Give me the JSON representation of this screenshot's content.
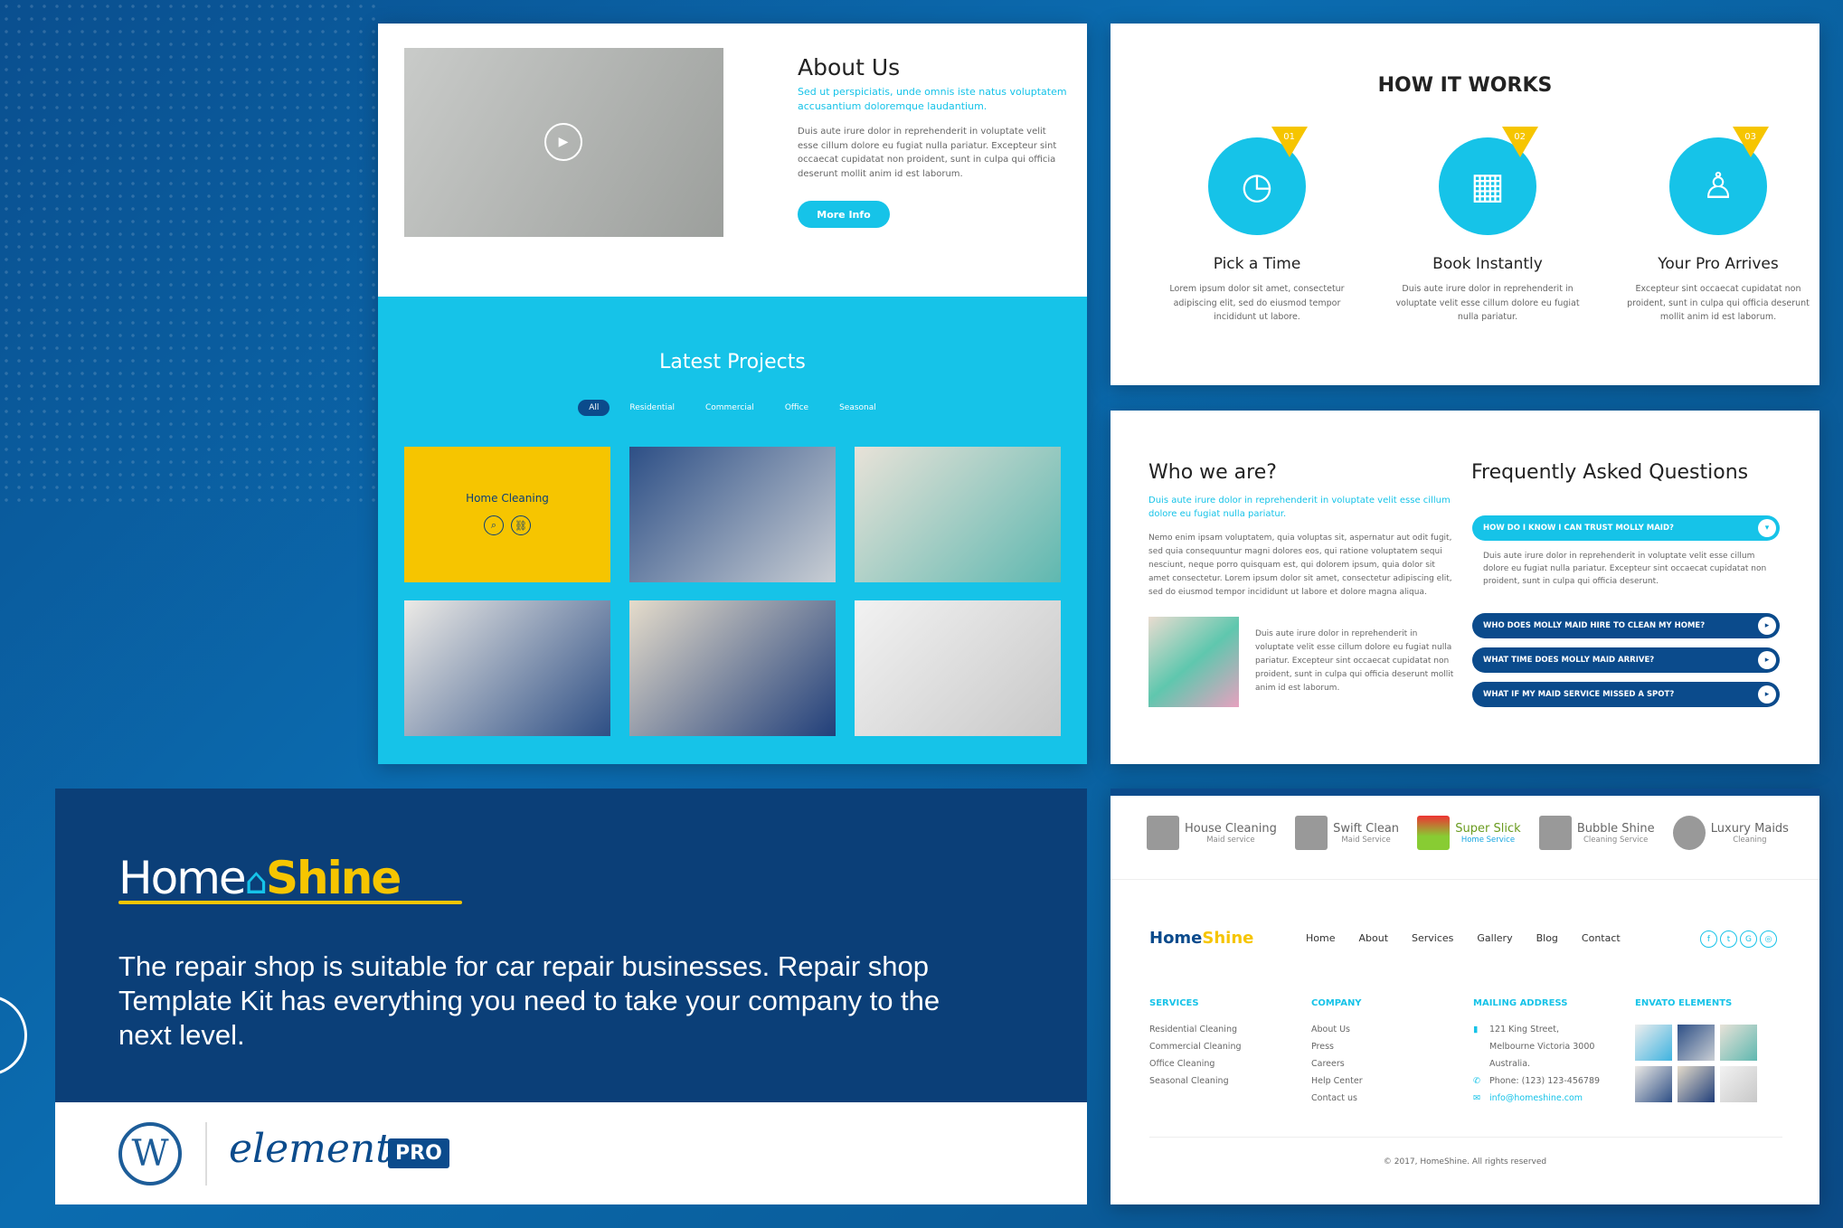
{
  "about": {
    "title": "About Us",
    "lead": "Sed ut perspiciatis, unde omnis iste natus voluptatem accusantium doloremque laudantium.",
    "body": "Duis aute irure dolor in reprehenderit in voluptate velit esse cillum dolore eu fugiat nulla pariatur. Excepteur sint occaecat cupidatat non proident, sunt in culpa qui officia deserunt mollit anim id est laborum.",
    "button": "More Info"
  },
  "projects": {
    "title": "Latest Projects",
    "filters": [
      "All",
      "Residential",
      "Commercial",
      "Office",
      "Seasonal"
    ],
    "active_filter": "All",
    "first_tile_label": "Home Cleaning"
  },
  "how": {
    "title": "HOW IT WORKS",
    "steps": [
      {
        "num": "01",
        "title": "Pick a Time",
        "text": "Lorem ipsum dolor sit amet, consectetur adipiscing elit, sed do eiusmod tempor incididunt ut labore.",
        "icon": "clock-icon"
      },
      {
        "num": "02",
        "title": "Book Instantly",
        "text": "Duis aute irure dolor in reprehenderit in voluptate velit esse cillum dolore eu fugiat nulla pariatur.",
        "icon": "calendar-icon"
      },
      {
        "num": "03",
        "title": "Your Pro Arrives",
        "text": "Excepteur sint occaecat cupidatat non proident, sunt in culpa qui officia deserunt mollit anim id est laborum.",
        "icon": "maid-icon"
      }
    ]
  },
  "who": {
    "title": "Who we are?",
    "lead": "Duis aute irure dolor in reprehenderit in voluptate velit esse cillum dolore eu fugiat nulla pariatur.",
    "body": "Nemo enim ipsam voluptatem, quia voluptas sit, aspernatur aut odit fugit, sed quia consequuntur magni dolores eos, qui ratione voluptatem sequi nesciunt, neque porro quisquam est, qui dolorem ipsum, quia dolor sit amet consectetur. Lorem ipsum dolor sit amet, consectetur adipiscing elit, sed do eiusmod tempor incididunt ut labore et dolore magna aliqua.",
    "side": "Duis aute irure dolor in reprehenderit in voluptate velit esse cillum dolore eu fugiat nulla pariatur. Excepteur sint occaecat cupidatat non proident, sunt in culpa qui officia deserunt mollit anim id est laborum."
  },
  "faq": {
    "title": "Frequently Asked Questions",
    "items": [
      {
        "q": "HOW DO I KNOW I CAN TRUST MOLLY MAID?",
        "open": true,
        "a": "Duis aute irure dolor in reprehenderit in voluptate velit esse cillum dolore eu fugiat nulla pariatur. Excepteur sint occaecat cupidatat non proident, sunt in culpa qui officia deserunt."
      },
      {
        "q": "WHO DOES MOLLY MAID HIRE TO CLEAN MY HOME?",
        "open": false
      },
      {
        "q": "WHAT TIME DOES MOLLY MAID ARRIVE?",
        "open": false
      },
      {
        "q": "WHAT IF MY MAID SERVICE MISSED A SPOT?",
        "open": false
      }
    ]
  },
  "clients": [
    {
      "name": "House Cleaning",
      "sub": "Maid service"
    },
    {
      "name": "Swift Clean",
      "sub": "Maid Service"
    },
    {
      "name": "Super Slick",
      "sub": "Home Service"
    },
    {
      "name": "Bubble Shine",
      "sub": "Cleaning Service"
    },
    {
      "name": "Luxury Maids",
      "sub": "Cleaning"
    }
  ],
  "footer": {
    "logo_home": "Home",
    "logo_shine": "Shine",
    "nav": [
      "Home",
      "About",
      "Services",
      "Gallery",
      "Blog",
      "Contact"
    ],
    "social": [
      "facebook-icon",
      "twitter-icon",
      "googleplus-icon",
      "instagram-icon"
    ],
    "services": {
      "title": "SERVICES",
      "items": [
        "Residential Cleaning",
        "Commercial Cleaning",
        "Office Cleaning",
        "Seasonal Cleaning"
      ]
    },
    "company": {
      "title": "COMPANY",
      "items": [
        "About Us",
        "Press",
        "Careers",
        "Help Center",
        "Contact us"
      ]
    },
    "mailing": {
      "title": "MAILING ADDRESS",
      "address": [
        "121 King Street,",
        "Melbourne Victoria 3000",
        "Australia."
      ],
      "phone": "Phone: (123) 123-456789",
      "email": "info@homeshine.com"
    },
    "envato": {
      "title": "ENVATO ELEMENTS"
    },
    "copyright": "© 2017, HomeShine. All rights reserved"
  },
  "promo": {
    "logo_home": "Home",
    "logo_shine": "Shine",
    "text": "The repair shop is suitable for car repair businesses. Repair shop Template Kit has everything you need to take your company to the next level.",
    "elementor": "elementor",
    "pro": "PRO"
  },
  "colors": {
    "cyan": "#16c3e8",
    "navy": "#0b4b8c",
    "yellow": "#f6c500"
  }
}
